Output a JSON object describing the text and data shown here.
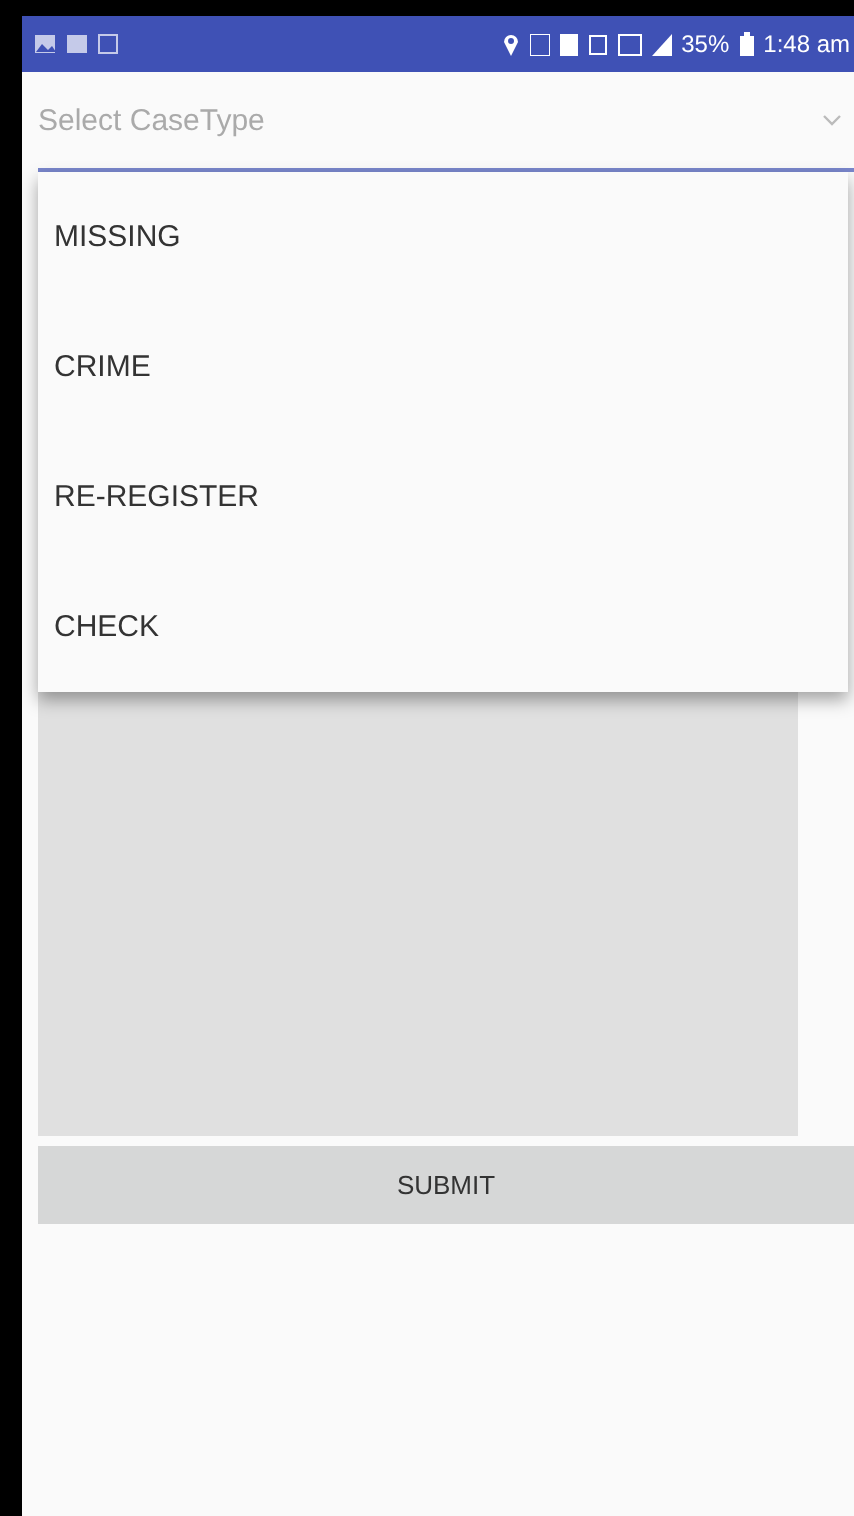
{
  "status_bar": {
    "battery": "35%",
    "time": "1:48 am"
  },
  "spinner": {
    "placeholder": "Select CaseType"
  },
  "dropdown": {
    "items": [
      {
        "label": "MISSING"
      },
      {
        "label": "CRIME"
      },
      {
        "label": "RE-REGISTER"
      },
      {
        "label": "CHECK"
      }
    ]
  },
  "submit_button": {
    "label": "SUBMIT"
  }
}
